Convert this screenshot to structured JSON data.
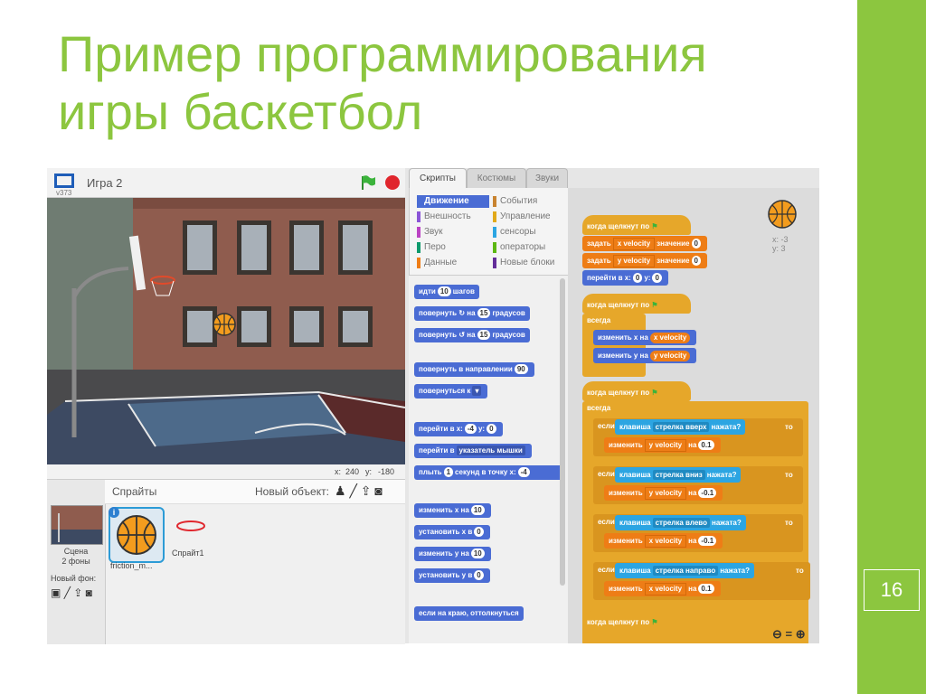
{
  "slide": {
    "title_line1": "Пример программирования",
    "title_line2": "игры баскетбол",
    "number": "16"
  },
  "stage": {
    "version": "v373",
    "title": "Игра 2",
    "x_label": "x:",
    "x_value": "240",
    "y_label": "y:",
    "y_value": "-180"
  },
  "sprites": {
    "title": "Спрайты",
    "new_object": "Новый объект:",
    "stage_label_1": "Сцена",
    "stage_label_2": "2 фоны",
    "new_bg": "Новый фон:",
    "sprite1_name": "friction_m...",
    "sprite2_name": "Спрайт1"
  },
  "tabs": [
    "Скрипты",
    "Костюмы",
    "Звуки"
  ],
  "categories": [
    {
      "label": "Движение",
      "color": "#4a6cd4"
    },
    {
      "label": "События",
      "color": "#c88330"
    },
    {
      "label": "Внешность",
      "color": "#8a55d7"
    },
    {
      "label": "Управление",
      "color": "#e1a91a"
    },
    {
      "label": "Звук",
      "color": "#bb42c3"
    },
    {
      "label": "сенсоры",
      "color": "#2ca5e2"
    },
    {
      "label": "Перо",
      "color": "#0e9a6c"
    },
    {
      "label": "операторы",
      "color": "#5cb712"
    },
    {
      "label": "Данные",
      "color": "#ee7d16"
    },
    {
      "label": "Новые блоки",
      "color": "#632d99"
    }
  ],
  "palette": {
    "move": "идти",
    "move_val": "10",
    "move_unit": "шагов",
    "turn_cw": "повернуть",
    "turn_on": "на",
    "turn_val": "15",
    "turn_unit": "градусов",
    "turn_ccw": "повернуть",
    "point_dir": "повернуть в направлении",
    "point_dir_val": "90",
    "point_to": "повернуться к",
    "goto_xy": "перейти в x:",
    "goto_x": "-4",
    "goto_y_label": "y:",
    "goto_y": "0",
    "goto": "перейти в",
    "goto_target": "указатель мышки",
    "glide": "плыть",
    "glide_val": "1",
    "glide_mid": "секунд в точку x:",
    "glide_x": "-4",
    "change_x": "изменить х на",
    "change_x_val": "10",
    "set_x": "установить х в",
    "set_x_val": "0",
    "change_y": "изменить у на",
    "change_y_val": "10",
    "set_y": "установить у в",
    "set_y_val": "0",
    "bounce": "если на краю, оттолкнуться"
  },
  "scripts": {
    "when_flag": "когда щелкнут по",
    "set": "задать",
    "to_value": "значение",
    "x_velocity": "x velocity",
    "y_velocity": "y velocity",
    "zero": "0",
    "goto_x": "перейти в x:",
    "goto_y": "y:",
    "forever": "всегда",
    "change_x_by": "изменить х на",
    "change_y_by": "изменить у на",
    "if": "если",
    "key": "клавиша",
    "pressed": "нажата?",
    "then": "то",
    "change": "изменить",
    "by": "на",
    "key_up": "стрелка вверх",
    "key_down": "стрелка вниз",
    "key_left": "стрелка влево",
    "key_right": "стрелка направо",
    "v_up": "0.1",
    "v_down": "-0.1",
    "v_left": "-0.1",
    "v_right": "0.1",
    "sprite_x": "x: -3",
    "sprite_y": "y: 3"
  }
}
